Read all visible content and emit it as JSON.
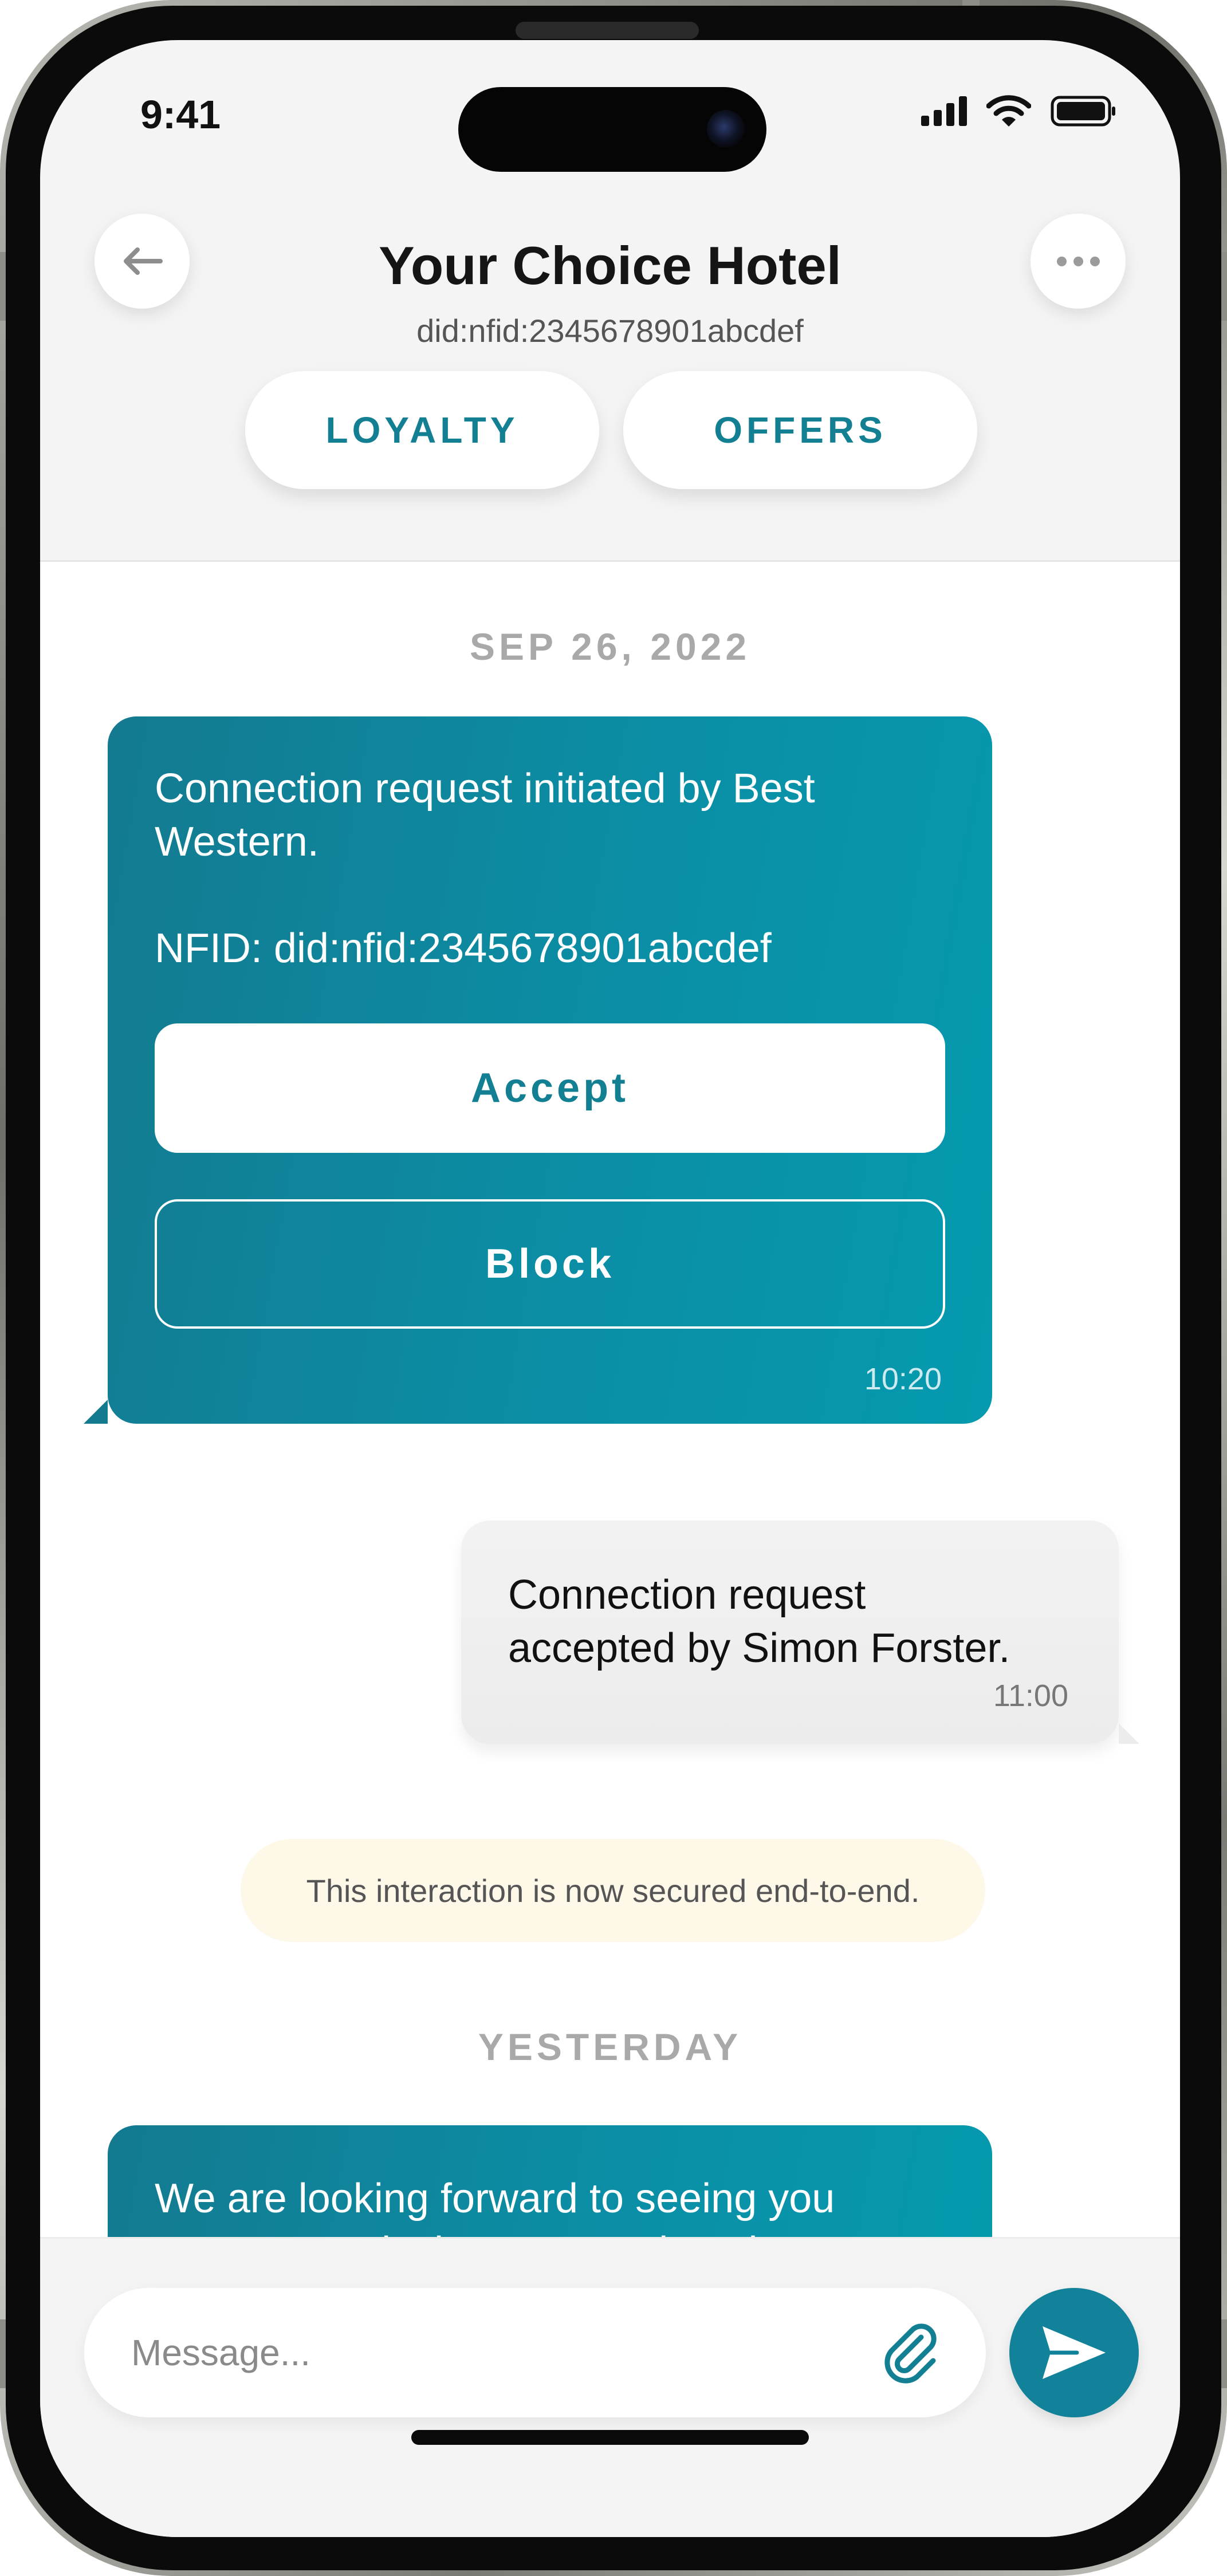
{
  "status_bar": {
    "time": "9:41",
    "icons": [
      "cellular-signal-icon",
      "wifi-icon",
      "battery-icon"
    ]
  },
  "header": {
    "title": "Your Choice Hotel",
    "subtitle": "did:nfid:2345678901abcdef",
    "back_icon": "arrow-left-icon",
    "more_icon": "ellipsis-icon",
    "tabs": [
      {
        "label": "LOYALTY"
      },
      {
        "label": "OFFERS"
      }
    ]
  },
  "chat": {
    "date_separators": [
      "SEP 26, 2022",
      "YESTERDAY"
    ],
    "connection_request": {
      "line1": "Connection request initiated by Best",
      "line2": "Western.",
      "nfid": "NFID: did:nfid:2345678901abcdef",
      "accept_label": "Accept",
      "block_label": "Block",
      "time": "10:20"
    },
    "accepted_message": {
      "line1": "Connection request",
      "line2": "accepted by Simon Forster.",
      "time": "11:00"
    },
    "secure_notice": "This interaction is now secured end-to-end.",
    "last_message": {
      "line1": "We are looking forward to seeing you",
      "line2": "tomorrow. It is time to complete the"
    }
  },
  "composer": {
    "placeholder": "Message...",
    "attach_icon": "paperclip-icon",
    "send_icon": "send-icon"
  },
  "colors": {
    "accent": "#127f93",
    "bubble_incoming": "#0b8ea5",
    "bubble_outgoing": "#efefef",
    "secure_banner": "#fdf8e7",
    "background": "#f4f4f4"
  }
}
